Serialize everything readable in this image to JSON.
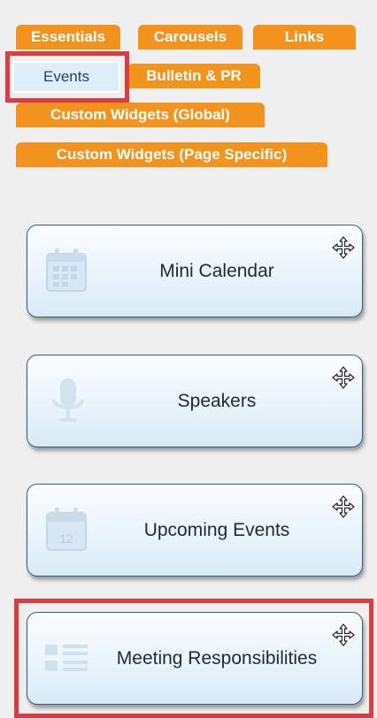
{
  "tabs": [
    {
      "label": "Essentials"
    },
    {
      "label": "Carousels"
    },
    {
      "label": "Links"
    },
    {
      "label": "Events"
    },
    {
      "label": "Bulletin & PR"
    },
    {
      "label": "Custom Widgets (Global)"
    },
    {
      "label": "Custom Widgets (Page Specific)"
    }
  ],
  "active_tab": "Events",
  "widgets": [
    {
      "label": "Mini Calendar",
      "icon": "calendar-grid-icon"
    },
    {
      "label": "Speakers",
      "icon": "microphone-icon"
    },
    {
      "label": "Upcoming Events",
      "icon": "calendar-date-icon",
      "icon_text": "12"
    },
    {
      "label": "Meeting Responsibilities",
      "icon": "list-icon"
    }
  ],
  "colors": {
    "tab_orange": "#f4921e",
    "highlight_red": "#e03a41",
    "widget_border": "#2f5f82",
    "icon_gray": "#c9dcea"
  }
}
